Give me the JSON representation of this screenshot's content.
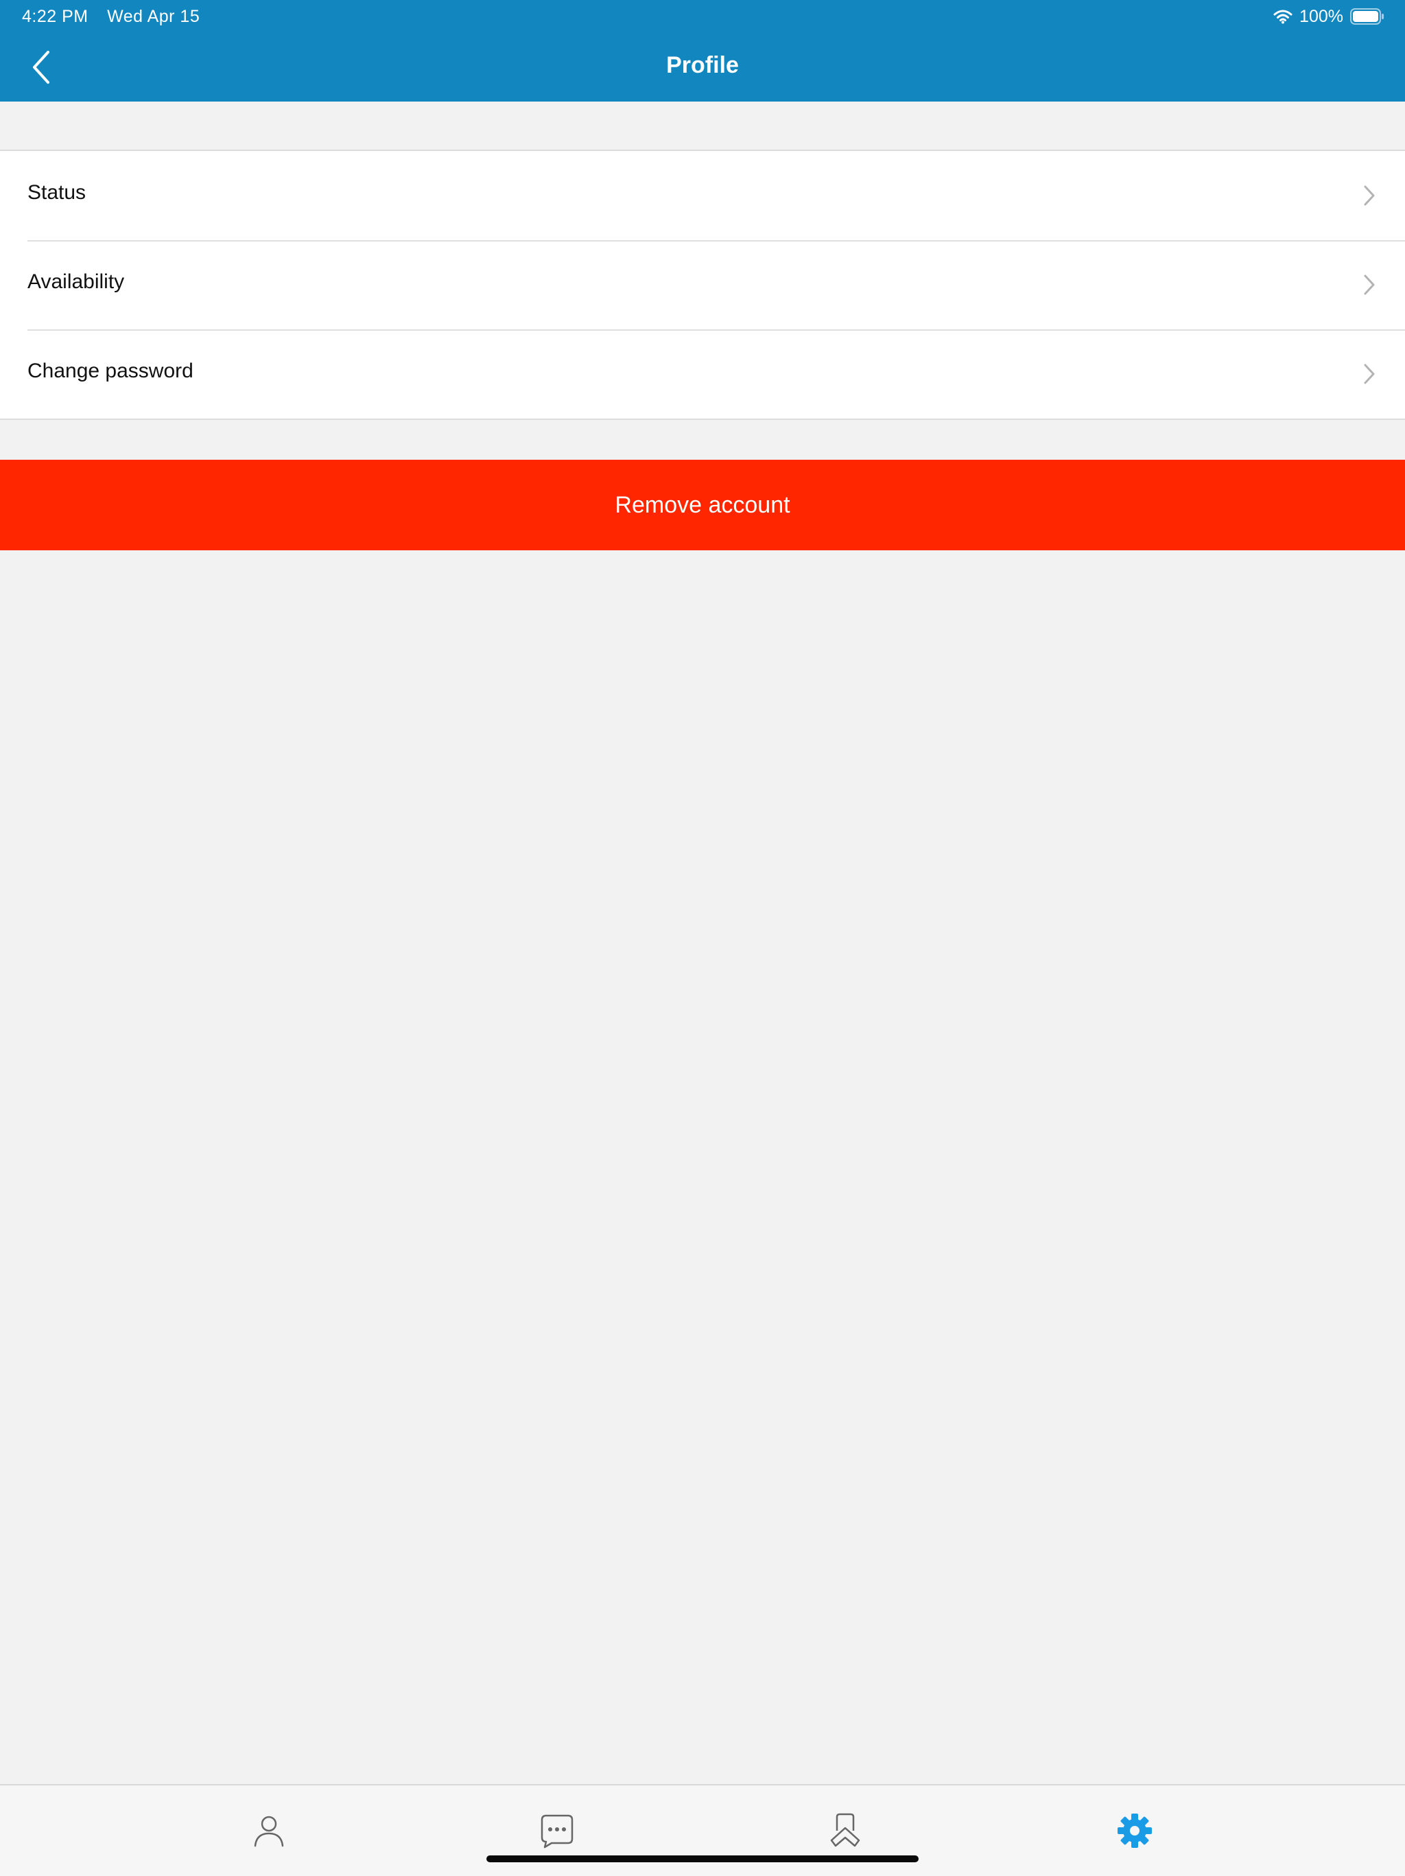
{
  "status_bar": {
    "time": "4:22 PM",
    "date": "Wed Apr 15",
    "battery": "100%"
  },
  "nav": {
    "title": "Profile",
    "back_icon": "chevron-left-icon"
  },
  "menu": [
    {
      "label": "Status"
    },
    {
      "label": "Availability"
    },
    {
      "label": "Change password"
    }
  ],
  "remove_account": {
    "label": "Remove account"
  },
  "tabs": [
    {
      "icon": "person-icon",
      "active": false
    },
    {
      "icon": "chat-bubble-icon",
      "active": false
    },
    {
      "icon": "hands-icon",
      "active": false
    },
    {
      "icon": "gear-icon",
      "active": true
    }
  ],
  "colors": {
    "nav_bar": "#1286bf",
    "destructive": "#ff2600",
    "active_tab": "#1a9be6",
    "inactive_tab": "#666666",
    "background": "#f2f2f2"
  }
}
